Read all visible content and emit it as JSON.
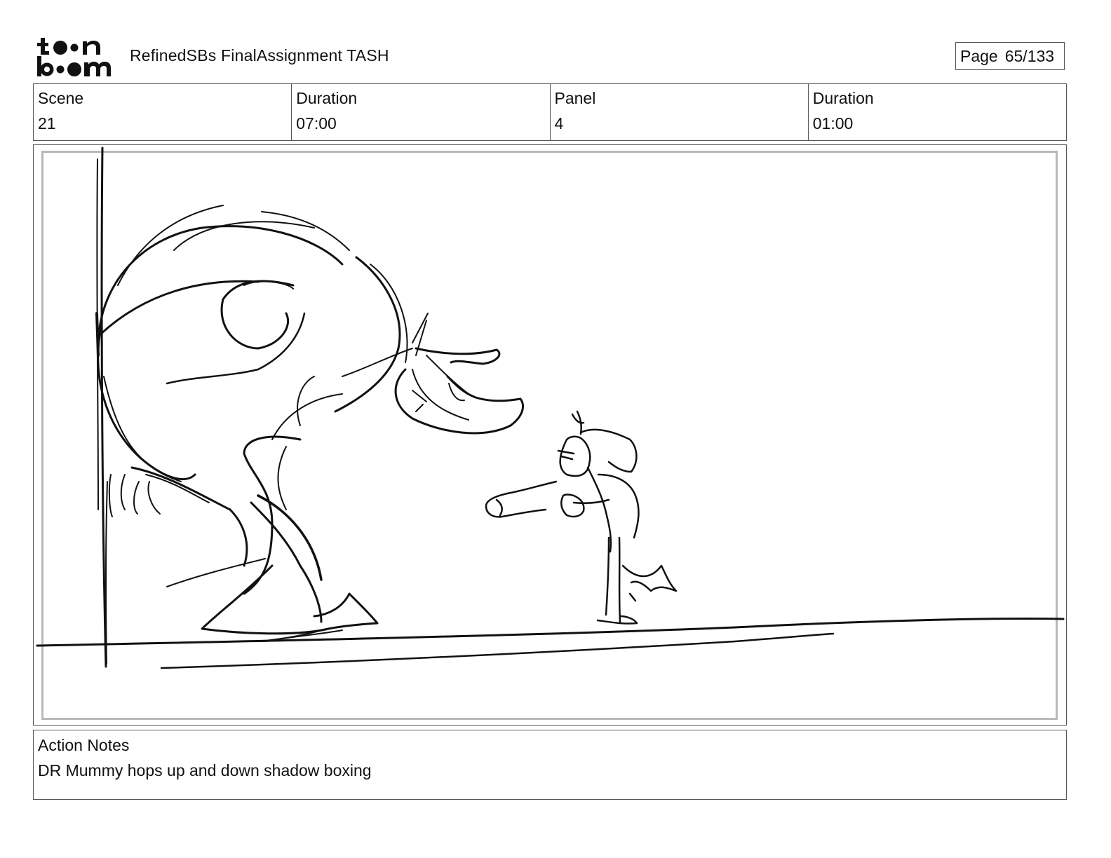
{
  "header": {
    "logo_text_top": "to•n",
    "logo_text_bottom": "b••m",
    "document_title": "RefinedSBs FinalAssignment TASH",
    "page_label": "Page",
    "page_value": "65/133"
  },
  "info": {
    "scene_label": "Scene",
    "scene_value": "21",
    "scene_duration_label": "Duration",
    "scene_duration_value": "07:00",
    "panel_label": "Panel",
    "panel_value": "4",
    "panel_duration_label": "Duration",
    "panel_duration_value": "01:00"
  },
  "notes": {
    "label": "Action Notes",
    "text": "DR Mummy hops up and down shadow boxing"
  }
}
